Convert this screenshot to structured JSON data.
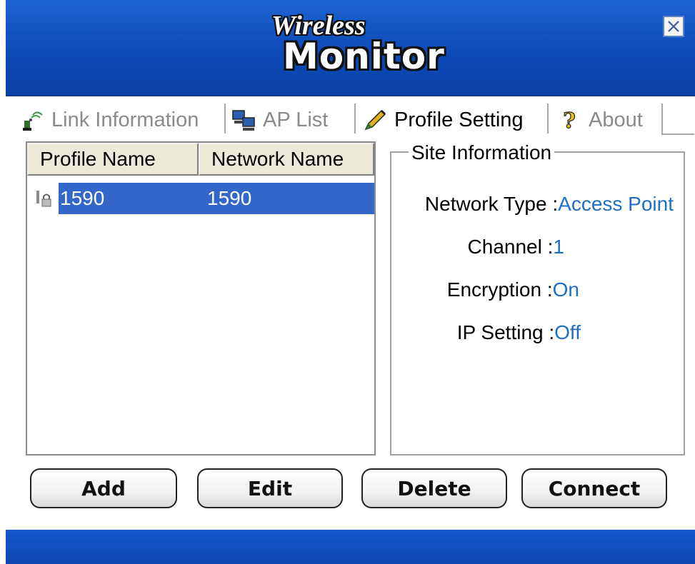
{
  "window": {
    "title_script": "Wireless",
    "title_main": "Monitor"
  },
  "tabs": [
    {
      "label": "Link Information",
      "icon": "wireless-signal-icon",
      "active": false
    },
    {
      "label": "AP List",
      "icon": "computers-icon",
      "active": false
    },
    {
      "label": "Profile Setting",
      "icon": "pencil-icon",
      "active": true
    },
    {
      "label": "About",
      "icon": "question-mark-icon",
      "active": false
    }
  ],
  "profile_list": {
    "columns": [
      "Profile Name",
      "Network Name"
    ],
    "rows": [
      {
        "profile_name": "1590",
        "network_name": "1590",
        "icon": "lock-icon",
        "selected": true
      }
    ]
  },
  "site_information": {
    "legend": "Site Information",
    "network_type_label": "Network Type :",
    "network_type_value": "Access Point",
    "channel_label": "Channel :",
    "channel_value": "1",
    "encryption_label": "Encryption :",
    "encryption_value": "On",
    "ip_setting_label": "IP Setting :",
    "ip_setting_value": "Off"
  },
  "buttons": {
    "add": "Add",
    "edit": "Edit",
    "delete": "Delete",
    "connect": "Connect"
  },
  "colors": {
    "title_blue": "#0d4bb8",
    "selection_blue": "#3566c9",
    "value_blue": "#1f6fc7"
  }
}
